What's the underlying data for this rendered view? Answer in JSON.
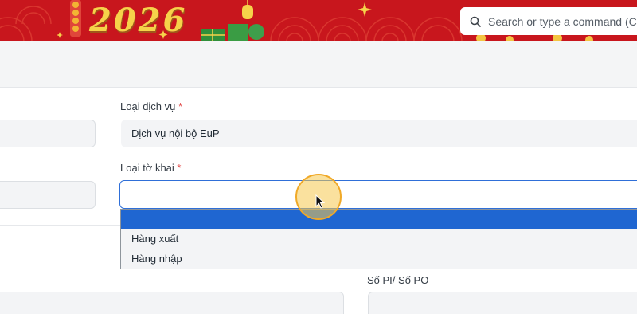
{
  "banner": {
    "year": "2026",
    "search_placeholder": "Search or type a command (C"
  },
  "form": {
    "service_type": {
      "label": "Loại dịch vụ",
      "required_mark": "*",
      "value": "Dịch vụ nội bộ EuP"
    },
    "declaration_type": {
      "label": "Loại tờ khai",
      "required_mark": "*",
      "value": "",
      "options": [
        "",
        "Hàng xuất",
        "Hàng nhập"
      ],
      "highlighted_index": 0
    },
    "pi_po": {
      "label": "Số PI/ Số PO"
    }
  },
  "colors": {
    "banner_red": "#c8161d",
    "accent_blue": "#1f66d1",
    "required_red": "#e24c4b",
    "gold": "#f6d24a"
  }
}
